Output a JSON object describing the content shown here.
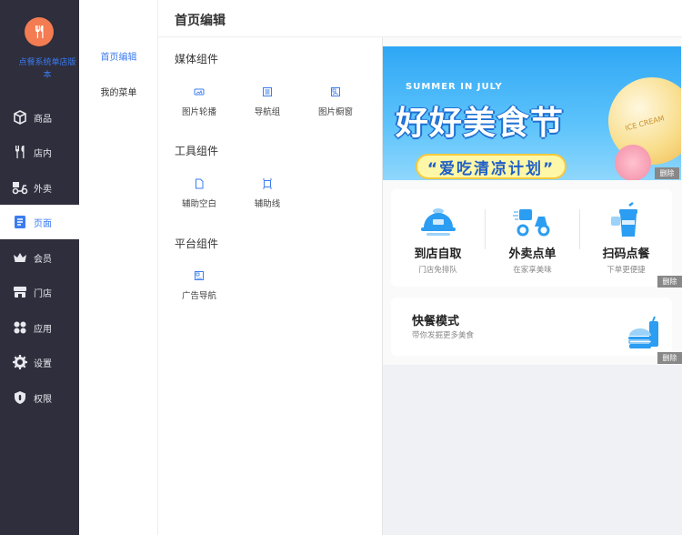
{
  "app": {
    "shop_name": "点餐系统单店版本"
  },
  "nav": {
    "items": [
      {
        "label": "商品",
        "icon": "box-icon"
      },
      {
        "label": "店内",
        "icon": "utensils-icon"
      },
      {
        "label": "外卖",
        "icon": "scooter-icon"
      },
      {
        "label": "页面",
        "icon": "page-icon",
        "active": true
      },
      {
        "label": "会员",
        "icon": "crown-icon"
      },
      {
        "label": "门店",
        "icon": "store-icon"
      },
      {
        "label": "应用",
        "icon": "apps-icon"
      },
      {
        "label": "设置",
        "icon": "gear-icon"
      },
      {
        "label": "权限",
        "icon": "shield-icon"
      }
    ]
  },
  "subnav": {
    "items": [
      {
        "label": "首页编辑",
        "active": true
      },
      {
        "label": "我的菜单"
      }
    ]
  },
  "header": {
    "title": "首页编辑"
  },
  "components": {
    "media": {
      "title": "媒体组件",
      "items": [
        "图片轮播",
        "导航组",
        "图片橱窗"
      ]
    },
    "tools": {
      "title": "工具组件",
      "items": [
        "辅助空白",
        "辅助线"
      ]
    },
    "platform": {
      "title": "平台组件",
      "items": [
        "广告导航"
      ]
    }
  },
  "preview": {
    "banner": {
      "subtitle": "SUMMER IN JULY",
      "title": "好好美食节",
      "slogan": "“爱吃清凉计划”",
      "deco_text": "ICE CREAM"
    },
    "delete_label": "删除",
    "services": [
      {
        "title": "到店自取",
        "subtitle": "门店免排队",
        "icon": "food-tray-icon"
      },
      {
        "title": "外卖点单",
        "subtitle": "在家享美味",
        "icon": "delivery-scooter-icon"
      },
      {
        "title": "扫码点餐",
        "subtitle": "下单更便捷",
        "icon": "drink-cup-icon"
      }
    ],
    "fast_mode": {
      "title": "快餐模式",
      "subtitle": "带你发掘更多美食",
      "icon": "burger-drink-icon"
    }
  },
  "colors": {
    "nav_bg": "#2f2e3c",
    "accent": "#3b7cf0",
    "logo": "#f47c52",
    "service_icon": "#2b9df2"
  }
}
